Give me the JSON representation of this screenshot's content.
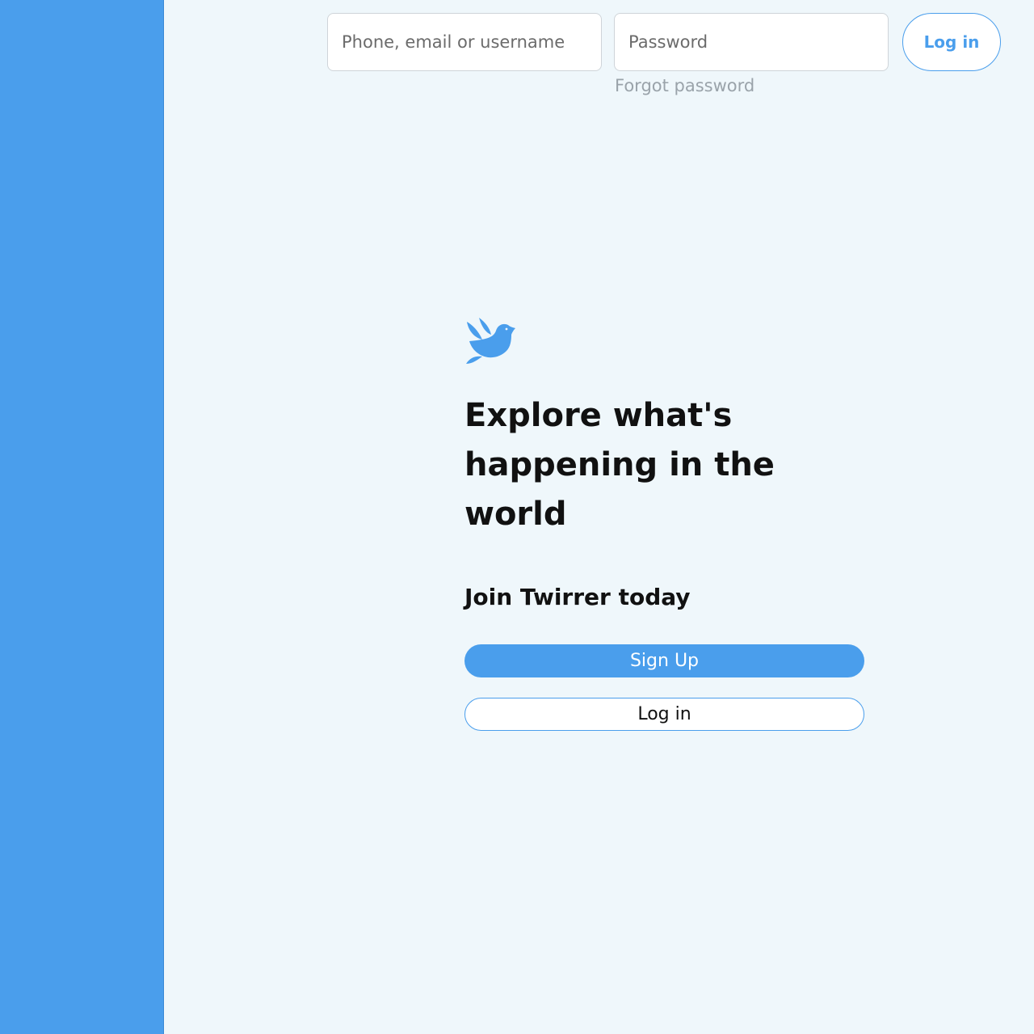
{
  "brand": {
    "name": "Twirrer",
    "accent_color": "#4a9eec",
    "logo_icon": "dove-icon"
  },
  "login_bar": {
    "username_placeholder": "Phone, email or username",
    "password_placeholder": "Password",
    "forgot_password_label": "Forgot password",
    "login_button_label": "Log in"
  },
  "hero": {
    "headline": "Explore what's happening in the world",
    "subheadline": "Join Twirrer today",
    "signup_button_label": "Sign Up",
    "login_button_label": "Log in"
  }
}
